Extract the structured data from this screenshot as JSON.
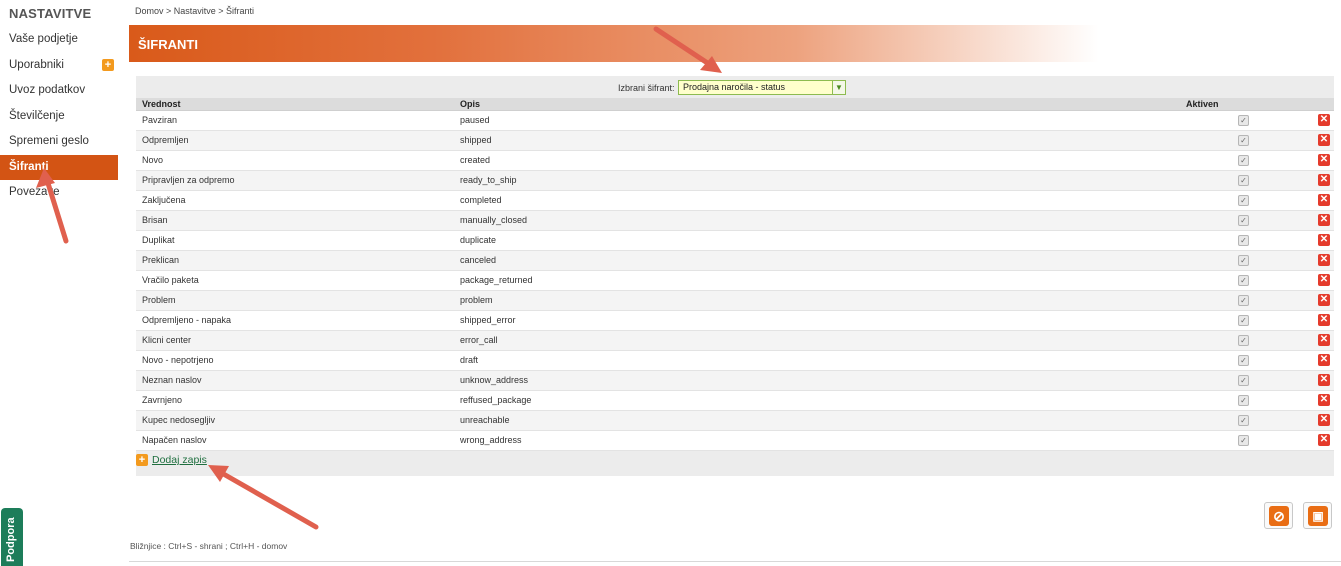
{
  "sidebar": {
    "title": "NASTAVITVE",
    "items": [
      {
        "label": "Vaše podjetje"
      },
      {
        "label": "Uporabniki",
        "badge": "+"
      },
      {
        "label": "Uvoz podatkov"
      },
      {
        "label": "Številčenje"
      },
      {
        "label": "Spremeni geslo"
      },
      {
        "label": "Šifranti",
        "active": true
      },
      {
        "label": "Povezave"
      }
    ],
    "support_label": "Podpora"
  },
  "breadcrumb": "Domov  >  Nastavitve  >  Šifranti",
  "header": {
    "title": "ŠIFRANTI"
  },
  "selector": {
    "label": "Izbrani šifrant:",
    "value": "Prodajna naročila - status"
  },
  "table": {
    "columns": [
      "Vrednost",
      "Opis",
      "Aktiven",
      ""
    ],
    "rows": [
      {
        "vrednost": "Pavziran",
        "opis": "paused",
        "aktiven": true
      },
      {
        "vrednost": "Odpremljen",
        "opis": "shipped",
        "aktiven": true
      },
      {
        "vrednost": "Novo",
        "opis": "created",
        "aktiven": true
      },
      {
        "vrednost": "Pripravljen za odpremo",
        "opis": "ready_to_ship",
        "aktiven": true
      },
      {
        "vrednost": "Zaključena",
        "opis": "completed",
        "aktiven": true
      },
      {
        "vrednost": "Brisan",
        "opis": "manually_closed",
        "aktiven": true
      },
      {
        "vrednost": "Duplikat",
        "opis": "duplicate",
        "aktiven": true
      },
      {
        "vrednost": "Preklican",
        "opis": "canceled",
        "aktiven": true
      },
      {
        "vrednost": "Vračilo paketa",
        "opis": "package_returned",
        "aktiven": true
      },
      {
        "vrednost": "Problem",
        "opis": "problem",
        "aktiven": true
      },
      {
        "vrednost": "Odpremljeno - napaka",
        "opis": "shipped_error",
        "aktiven": true
      },
      {
        "vrednost": "Klicni center",
        "opis": "error_call",
        "aktiven": true
      },
      {
        "vrednost": "Novo - nepotrjeno",
        "opis": "draft",
        "aktiven": true
      },
      {
        "vrednost": "Neznan naslov",
        "opis": "unknow_address",
        "aktiven": true
      },
      {
        "vrednost": "Zavrnjeno",
        "opis": "reffused_package",
        "aktiven": true
      },
      {
        "vrednost": "Kupec nedosegljiv",
        "opis": "unreachable",
        "aktiven": true
      },
      {
        "vrednost": "Napačen naslov",
        "opis": "wrong_address",
        "aktiven": true
      }
    ]
  },
  "add_record": "Dodaj zapis",
  "shortcuts": "Bližnjice : Ctrl+S - shrani ;  Ctrl+H - domov",
  "colors": {
    "accent": "#d35414",
    "annotation_arrow": "#e0604e",
    "delete": "#e43b2c"
  }
}
